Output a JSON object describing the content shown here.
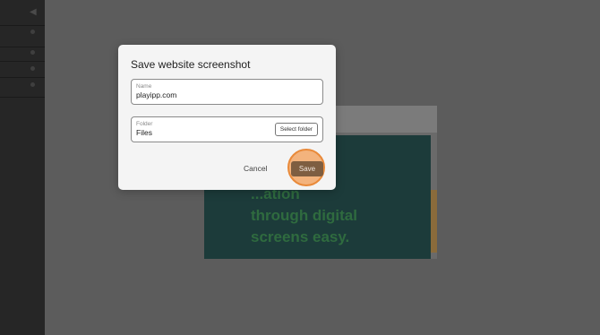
{
  "modal": {
    "title": "Save website screenshot",
    "name_field": {
      "label": "Name",
      "value": "playipp.com"
    },
    "folder_field": {
      "label": "Folder",
      "value": "Files",
      "select_label": "Select folder"
    },
    "cancel_label": "Cancel",
    "save_label": "Save"
  },
  "preview": {
    "headline": "...kes\n...ation\nthrough digital\nscreens easy."
  },
  "colors": {
    "overlay": "#5c5c5c",
    "modal_bg": "#f4f4f4",
    "save_button": "#7e5e41",
    "highlight_ring": "#f3b37d"
  }
}
